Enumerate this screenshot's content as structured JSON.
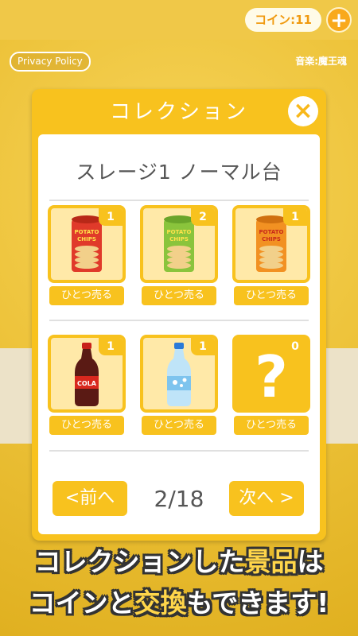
{
  "header": {
    "coin_label": "コイン:11",
    "plus_label": "+"
  },
  "privacy_label": "Privacy Policy",
  "music_credit": "音楽:魔王魂",
  "dialog": {
    "title": "コレクション",
    "close_label": "×",
    "stage_title": "スレージ1 ノーマル台",
    "items": [
      {
        "name": "potato-chips-red",
        "count": "1",
        "sell_label": "ひとつ売る",
        "icon": "chips-red-icon"
      },
      {
        "name": "potato-chips-green",
        "count": "2",
        "sell_label": "ひとつ売る",
        "icon": "chips-green-icon"
      },
      {
        "name": "potato-chips-orange",
        "count": "1",
        "sell_label": "ひとつ売る",
        "icon": "chips-orange-icon"
      },
      {
        "name": "cola-bottle",
        "count": "1",
        "sell_label": "ひとつ売る",
        "icon": "cola-bottle-icon"
      },
      {
        "name": "soda-bottle",
        "count": "1",
        "sell_label": "ひとつ売る",
        "icon": "soda-bottle-icon"
      },
      {
        "name": "unknown-item",
        "count": "0",
        "sell_label": "ひとつ売る",
        "icon": "question-mark-icon"
      }
    ],
    "prev_label": "<前へ",
    "next_label": "次へ >",
    "page": "2/18"
  },
  "chip_label_top": "POTATO",
  "chip_label_bottom": "CHIPS",
  "cola_label": "COLA",
  "caption": {
    "line1_a": "コレクションした",
    "line1_b": "景品",
    "line1_c": "は",
    "line2_a": "コイン",
    "line2_b": "と",
    "line2_c": "交換",
    "line2_d": "もできます!"
  },
  "colors": {
    "accent": "#f8c21e",
    "chips_red": "#e03a2a",
    "chips_green": "#8ac43c",
    "chips_orange": "#f29122"
  }
}
